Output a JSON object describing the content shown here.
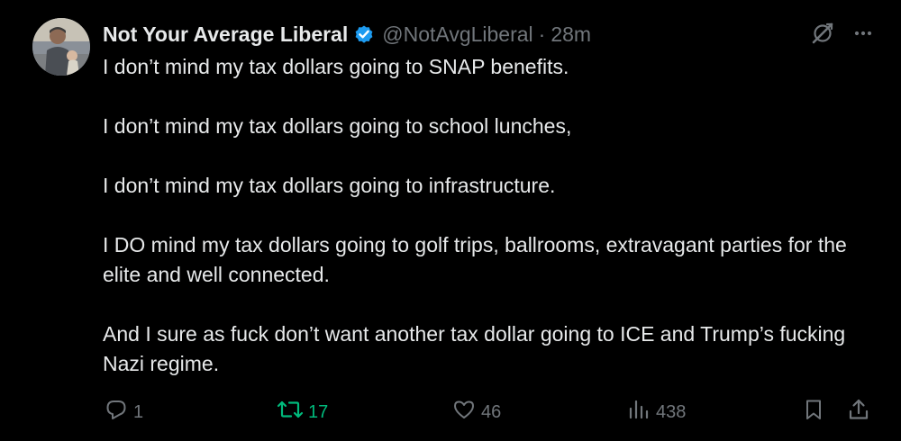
{
  "author": {
    "display_name": "Not Your Average Liberal",
    "handle": "@NotAvgLiberal",
    "separator": "·",
    "time": "28m",
    "verified": true,
    "verified_color": "#1d9bf0"
  },
  "tweet": {
    "paragraphs": [
      "I don’t mind my tax dollars going to SNAP benefits.",
      "I don’t mind my tax dollars going to school lunches,",
      "I don’t mind my tax dollars going to infrastructure.",
      "I DO mind my tax dollars going to golf trips, ballrooms, extravagant parties for the elite and well connected.",
      "And I sure as fuck don’t want another tax dollar going to ICE and Trump’s fucking Nazi regime."
    ]
  },
  "actions": {
    "reply": {
      "icon": "reply-icon",
      "count": "1"
    },
    "retweet": {
      "icon": "retweet-icon",
      "count": "17",
      "color": "#00ba7c"
    },
    "like": {
      "icon": "heart-icon",
      "count": "46"
    },
    "views": {
      "icon": "views-icon",
      "count": "438"
    },
    "bookmark": {
      "icon": "bookmark-icon"
    },
    "share": {
      "icon": "share-icon"
    }
  },
  "top_actions": {
    "grok": {
      "icon": "grok-icon"
    },
    "more": {
      "icon": "more-icon"
    }
  },
  "colors": {
    "background": "#000000",
    "text": "#e7e9ea",
    "secondary": "#71767b"
  }
}
